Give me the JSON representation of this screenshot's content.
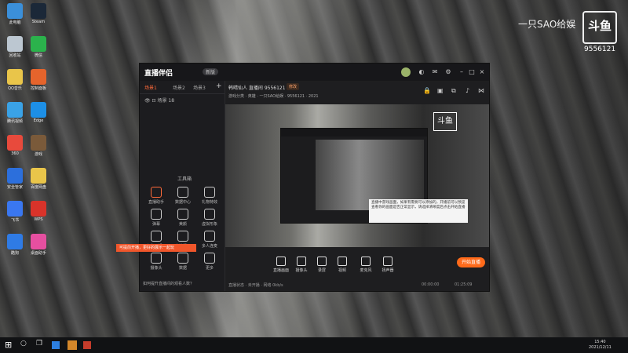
{
  "desktop": {
    "icons": [
      {
        "label": "此电脑",
        "color": "#3b8fd9"
      },
      {
        "label": "Steam",
        "color": "#1b2838"
      },
      {
        "label": "回收站",
        "color": "#bcc7d1"
      },
      {
        "label": "微信",
        "color": "#2bb24c"
      },
      {
        "label": "QQ音乐",
        "color": "#e9c54a"
      },
      {
        "label": "控制面板",
        "color": "#e5642c"
      },
      {
        "label": "腾讯视频",
        "color": "#3aa2e6"
      },
      {
        "label": "Edge",
        "color": "#1d8fe6"
      },
      {
        "label": "360",
        "color": "#e84a3c"
      },
      {
        "label": "游戏",
        "color": "#7a5a3a"
      },
      {
        "label": "安全管家",
        "color": "#2c6fdc"
      },
      {
        "label": "百度网盘",
        "color": "#e9c54a"
      },
      {
        "label": "飞书",
        "color": "#3a77f0"
      },
      {
        "label": "WPS",
        "color": "#d9332a"
      },
      {
        "label": "酷狗",
        "color": "#2f7be5"
      },
      {
        "label": "桌面助手",
        "color": "#e64fa0"
      }
    ]
  },
  "brand": {
    "text": "一只SAO给娱",
    "logo": "斗鱼",
    "room": "9556121"
  },
  "window": {
    "app_name": "直播伴侣",
    "version": "新版",
    "left_tabs": [
      "场景1",
      "场景2",
      "场景3"
    ],
    "scene_label": "场景 18",
    "tools_title": "工具箱",
    "tools": [
      {
        "label": "直播助手"
      },
      {
        "label": "数据中心"
      },
      {
        "label": "礼物特效"
      },
      {
        "label": "弹幕"
      },
      {
        "label": "美颜"
      },
      {
        "label": "虚拟形象"
      },
      {
        "label": "上车一起玩"
      },
      {
        "label": "上榜提示"
      },
      {
        "label": "多人连麦"
      },
      {
        "label": "摄像头"
      },
      {
        "label": "数据"
      },
      {
        "label": "更多"
      }
    ],
    "hint": "可提前开播，更好的展示一起玩",
    "tip": "如何提升直播间的观看人数？",
    "title": "韩晴仙人 直播间 9556121",
    "tag": "修改",
    "sub": "游戏分类 · 英雄 · 一只SAO给娱 · 9556121 · 2021",
    "logo_overlay": "斗鱼",
    "notice": "直播中游戏画面，如果有需要可以添加的，开播前可以预览查看你的画面是否正常显示，请选择清晰度后点击开始直播",
    "controls": [
      {
        "label": "直播画面"
      },
      {
        "label": "摄像头"
      },
      {
        "label": "录屏"
      },
      {
        "label": "视频"
      },
      {
        "label": "麦克风"
      },
      {
        "label": "扬声器"
      }
    ],
    "start_label": "开始直播",
    "status": {
      "left": "直播状态 · 未开播 · 网络 0kb/s",
      "timer1": "00:00:00",
      "timer2": "01:25:09"
    }
  },
  "taskbar": {
    "time": "15:40",
    "date": "2021/12/11"
  }
}
